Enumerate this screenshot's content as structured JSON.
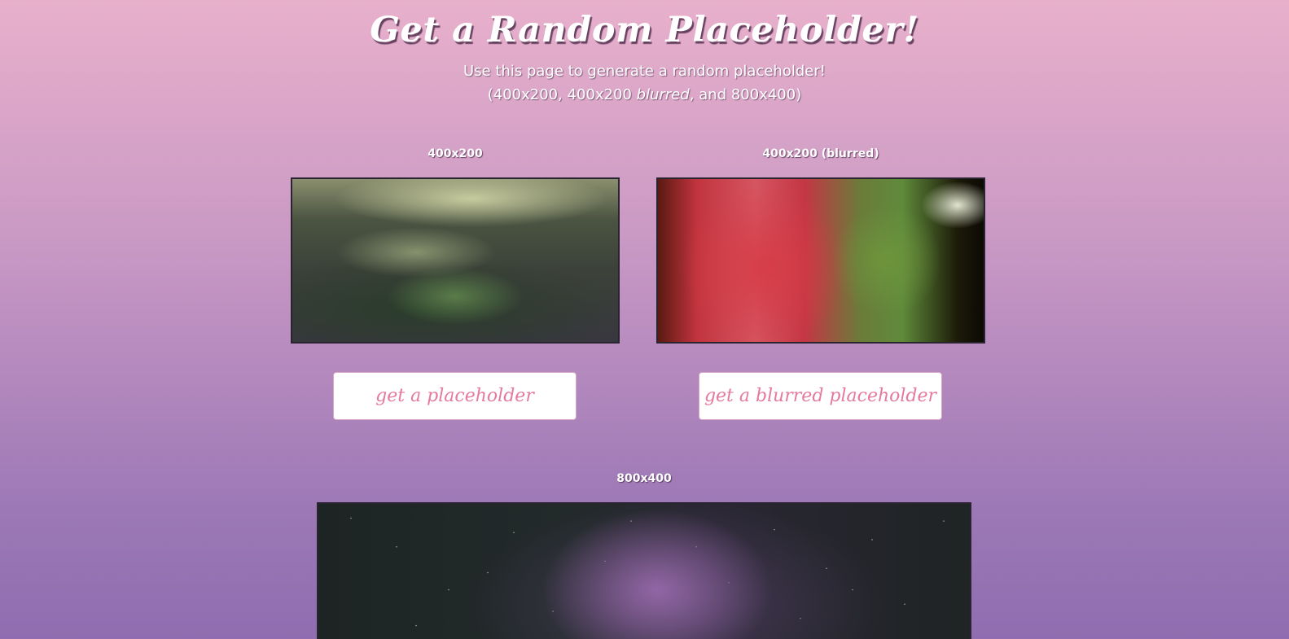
{
  "header": {
    "title": "Get a Random Placeholder!",
    "subtitle_line1": "Use this page to generate a random placeholder!",
    "subtitle_line2_a": "(400x200, 400x200 ",
    "subtitle_line2_em": "blurred",
    "subtitle_line2_b": ", and 800x400)"
  },
  "panels": {
    "left": {
      "label": "400x200",
      "button_label": "get a placeholder"
    },
    "right": {
      "label": "400x200 (blurred)",
      "button_label": "get a blurred placeholder"
    },
    "large": {
      "label": "800x400"
    }
  },
  "colors": {
    "background_top": "#e8b0cb",
    "background_bottom": "#8f6db0",
    "button_text": "#e5799f",
    "button_bg": "#ffffff"
  }
}
